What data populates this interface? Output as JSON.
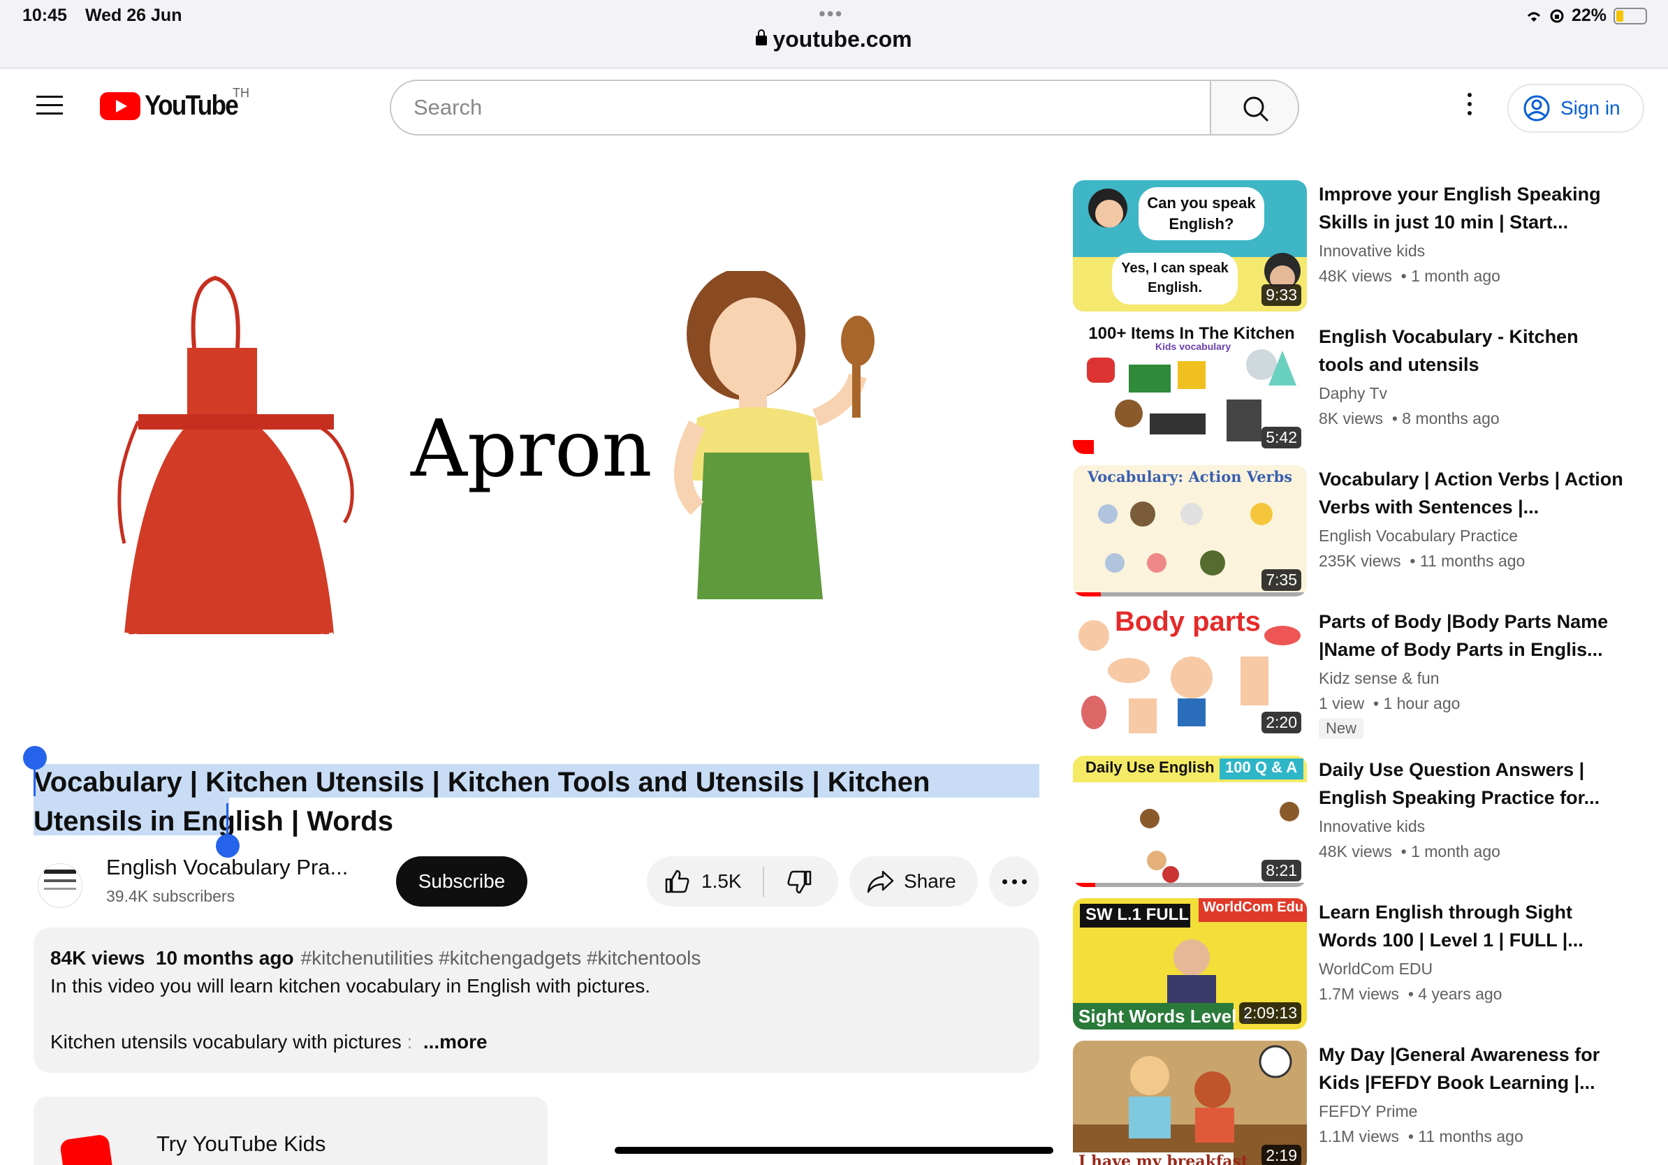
{
  "status_bar": {
    "time": "10:45",
    "date": "Wed 26 Jun",
    "url": "youtube.com",
    "battery": "22%"
  },
  "masthead": {
    "logo_text": "YouTube",
    "country_code": "TH",
    "search_placeholder": "Search",
    "sign_in": "Sign in"
  },
  "player": {
    "word": "Apron"
  },
  "video": {
    "title": "Vocabulary | Kitchen Utensils | Kitchen Tools and Utensils | Kitchen Utensils in English | Words",
    "channel": "English Vocabulary Pra...",
    "subscribers": "39.4K subscribers",
    "subscribe_label": "Subscribe",
    "likes": "1.5K",
    "share_label": "Share"
  },
  "description": {
    "views": "84K views",
    "age": "10 months ago",
    "tags": "#kitchenutilities #kitchengadgets #kitchentools",
    "line1": "In this video you will learn kitchen vocabulary in English with pictures.",
    "line2": "Kitchen utensils vocabulary with pictures",
    "colon": ":",
    "more": "...more"
  },
  "kids_card": {
    "title": "Try YouTube Kids"
  },
  "related": [
    {
      "title": "Improve your English Speaking Skills in just 10 min | Start...",
      "channel": "Innovative kids",
      "views": "48K views",
      "age": "1 month ago",
      "duration": "9:33",
      "thumb_text_1": "Can you speak English?",
      "thumb_text_2": "Yes, I can speak English."
    },
    {
      "title": "English Vocabulary - Kitchen tools and utensils",
      "channel": "Daphy Tv",
      "views": "8K views",
      "age": "8 months ago",
      "duration": "5:42",
      "thumb_text_1": "100+ Items In The Kitchen",
      "thumb_text_2": "Kids vocabulary"
    },
    {
      "title": "Vocabulary | Action Verbs | Action Verbs with Sentences |...",
      "channel": "English Vocabulary Practice",
      "views": "235K views",
      "age": "11 months ago",
      "duration": "7:35",
      "thumb_text_1": "Vocabulary: Action Verbs",
      "thumb_text_2": ""
    },
    {
      "title": "Parts of Body |Body Parts Name |Name of Body Parts in Englis...",
      "channel": "Kidz sense & fun",
      "views": "1 view",
      "age": "1 hour ago",
      "duration": "2:20",
      "badge": "New",
      "thumb_text_1": "Body parts",
      "thumb_text_2": ""
    },
    {
      "title": "Daily Use Question Answers | English Speaking Practice for...",
      "channel": "Innovative kids",
      "views": "48K views",
      "age": "1 month ago",
      "duration": "8:21",
      "thumb_text_1": "Daily Use English",
      "thumb_text_2": "100 Q & A"
    },
    {
      "title": "Learn English through Sight Words 100 | Level 1 | FULL |...",
      "channel": "WorldCom EDU",
      "views": "1.7M views",
      "age": "4 years ago",
      "duration": "2:09:13",
      "thumb_text_1": "SW L.1 FULL",
      "thumb_text_2": "WorldCom Edu",
      "thumb_text_3": "Sight Words Level 1"
    },
    {
      "title": "My Day |General Awareness for Kids |FEFDY Book Learning |...",
      "channel": "FEFDY Prime",
      "views": "1.1M views",
      "age": "11 months ago",
      "duration": "2:19",
      "thumb_text_1": "I have my breakfast",
      "thumb_text_2": ""
    }
  ],
  "colors": {
    "brand_red": "#ff0000",
    "link_blue": "#065fd4",
    "selection": "#c8dcf5",
    "handle_blue": "#2563eb"
  }
}
